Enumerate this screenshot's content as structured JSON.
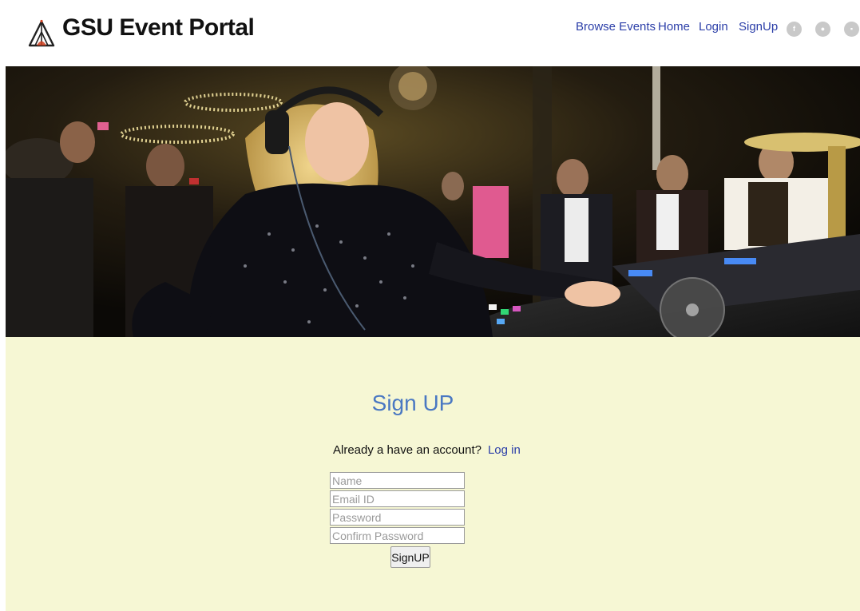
{
  "site": {
    "title": "GSU Event Portal",
    "logo_icon": "tent-logo-icon"
  },
  "nav": {
    "browse_events": "Browse Events",
    "home": "Home",
    "login": "Login",
    "signup": "SignUp"
  },
  "social": [
    {
      "icon": "facebook-icon",
      "glyph": "f"
    },
    {
      "icon": "twitter-icon",
      "glyph": "●"
    },
    {
      "icon": "youtube-icon",
      "glyph": "▪"
    }
  ],
  "hero": {
    "description_icon": "dj-party-photo"
  },
  "form": {
    "title": "Sign UP",
    "account_prompt": "Already a have an account?",
    "login_link": "Log in",
    "name_placeholder": "Name",
    "email_placeholder": "Email ID",
    "password_placeholder": "Password",
    "confirm_placeholder": "Confirm Password",
    "submit_label": "SignUP"
  },
  "colors": {
    "nav_link": "#2b3ea8",
    "title_blue": "#4a78c2",
    "panel_bg": "#f6f7d4"
  }
}
